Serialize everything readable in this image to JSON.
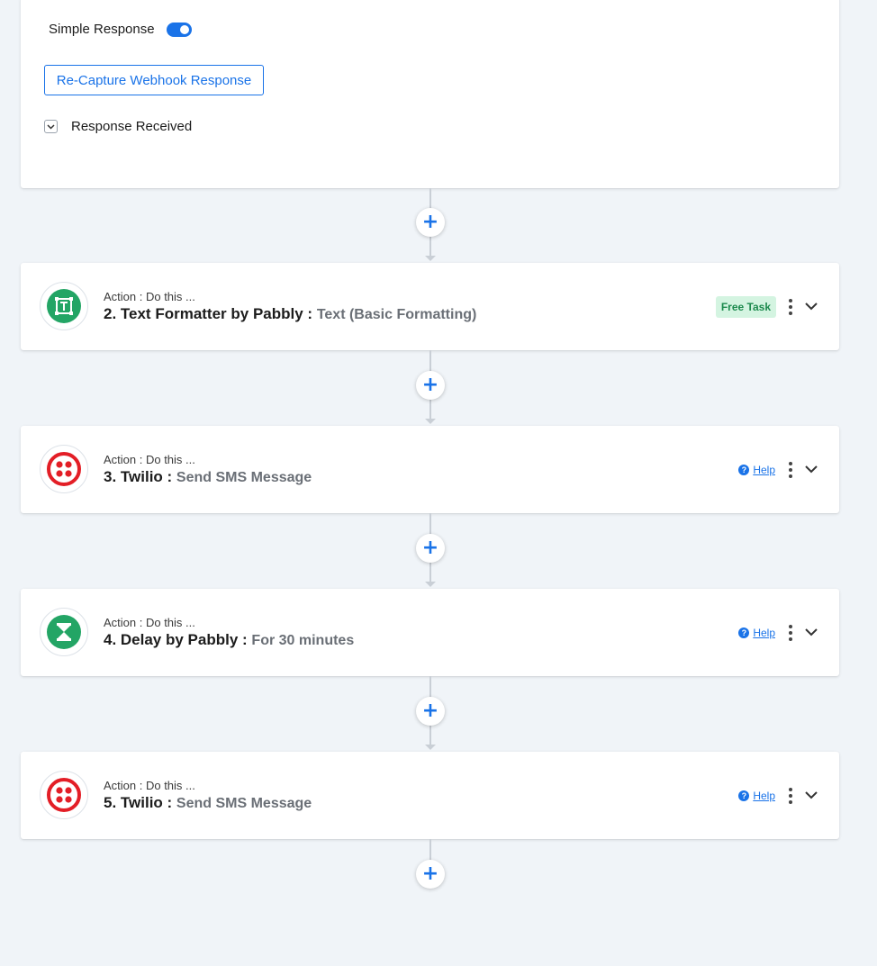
{
  "trigger": {
    "toggle_label": "Simple Response",
    "toggle_on": true,
    "recapture_label": "Re-Capture Webhook Response",
    "received_label": "Response Received"
  },
  "colors": {
    "accent": "#1a73e8",
    "pabbly_green": "#23a565",
    "twilio_red": "#e31e26"
  },
  "steps": [
    {
      "subtitle": "Action : Do this ...",
      "name": "2. Text Formatter by Pabbly :",
      "detail": "Text (Basic Formatting)",
      "badge": "Free Task",
      "icon": "text-formatter-icon"
    },
    {
      "subtitle": "Action : Do this ...",
      "name": "3. Twilio :",
      "detail": "Send SMS Message",
      "help": "Help",
      "icon": "twilio-icon"
    },
    {
      "subtitle": "Action : Do this ...",
      "name": "4. Delay by Pabbly :",
      "detail": "For 30 minutes",
      "help": "Help",
      "icon": "hourglass-icon"
    },
    {
      "subtitle": "Action : Do this ...",
      "name": "5. Twilio :",
      "detail": "Send SMS Message",
      "help": "Help",
      "icon": "twilio-icon"
    }
  ],
  "add_step_symbol": "+"
}
